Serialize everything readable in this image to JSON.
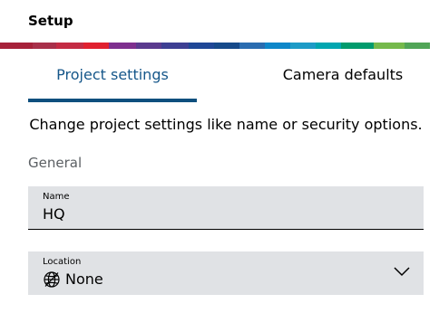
{
  "header": {
    "title": "Setup"
  },
  "brand_bar": {
    "colors": [
      "#a6213a",
      "#a8304a",
      "#c42b44",
      "#e0202f",
      "#7e2f8e",
      "#5a3a8e",
      "#3e3f93",
      "#1f4796",
      "#164a8a",
      "#2a6cb0",
      "#0e87c9",
      "#1d9bc7",
      "#00a6b0",
      "#009b6d",
      "#75b94b",
      "#51a557"
    ]
  },
  "tabs": [
    {
      "label": "Project settings",
      "selected": true
    },
    {
      "label": "Camera defaults",
      "selected": false
    }
  ],
  "description": "Change project settings like name or security options.",
  "section": {
    "title": "General"
  },
  "fields": {
    "name": {
      "label": "Name",
      "value": "HQ"
    },
    "location": {
      "label": "Location",
      "value": "None",
      "icon": "globe-icon"
    }
  },
  "colors": {
    "accent": "#16578a",
    "tab_indicator": "#0e4f7e",
    "field_background": "#e0e2e5",
    "section_label": "#5b5f63"
  }
}
